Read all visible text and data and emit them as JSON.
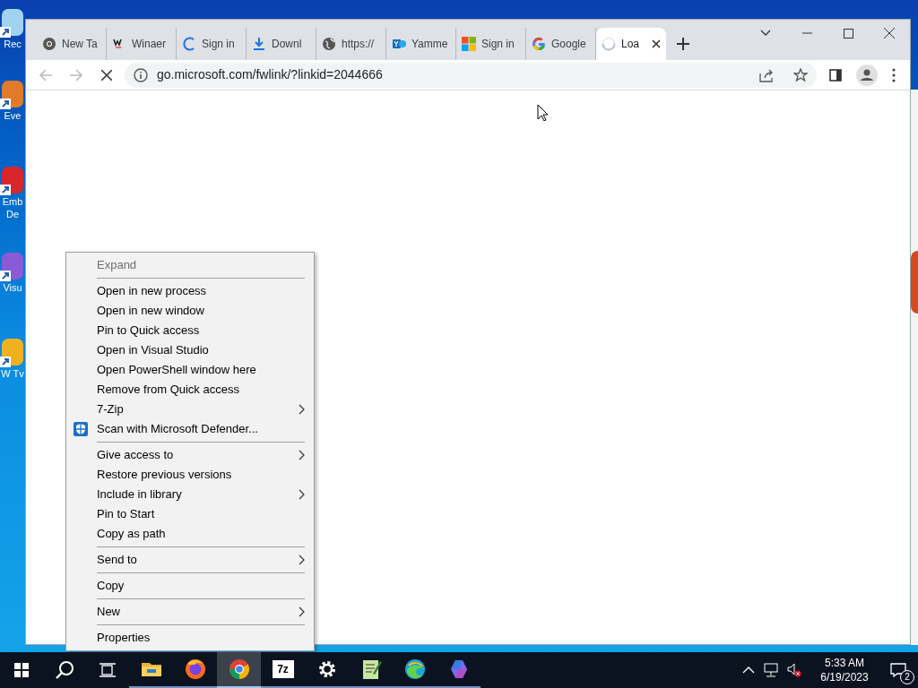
{
  "desktop_icons": [
    {
      "label": "Rec"
    },
    {
      "label": "Eve"
    },
    {
      "label": "Emb De"
    },
    {
      "label": "Visu"
    },
    {
      "label": "W Tv"
    }
  ],
  "browser": {
    "tabs": [
      {
        "label": "New Ta",
        "selected": false
      },
      {
        "label": "Winaer",
        "selected": false
      },
      {
        "label": "Sign in",
        "selected": false
      },
      {
        "label": "Downl",
        "selected": false
      },
      {
        "label": "https://",
        "selected": false
      },
      {
        "label": "Yamme",
        "selected": false
      },
      {
        "label": "Sign in",
        "selected": false
      },
      {
        "label": "Google",
        "selected": false
      },
      {
        "label": "Loa",
        "selected": true
      }
    ],
    "url": "go.microsoft.com/fwlink/?linkid=2044666"
  },
  "context_menu": [
    {
      "kind": "item",
      "label": "Expand",
      "disabled": true,
      "submenu": false
    },
    {
      "kind": "separator"
    },
    {
      "kind": "item",
      "label": "Open in new process",
      "disabled": false,
      "submenu": false
    },
    {
      "kind": "item",
      "label": "Open in new window",
      "disabled": false,
      "submenu": false
    },
    {
      "kind": "item",
      "label": "Pin to Quick access",
      "disabled": false,
      "submenu": false
    },
    {
      "kind": "item",
      "label": "Open in Visual Studio",
      "disabled": false,
      "submenu": false
    },
    {
      "kind": "item",
      "label": "Open PowerShell window here",
      "disabled": false,
      "submenu": false
    },
    {
      "kind": "item",
      "label": "Remove from Quick access",
      "disabled": false,
      "submenu": false
    },
    {
      "kind": "item",
      "label": "7-Zip",
      "disabled": false,
      "submenu": true
    },
    {
      "kind": "item",
      "label": "Scan with Microsoft Defender...",
      "disabled": false,
      "submenu": false
    },
    {
      "kind": "separator"
    },
    {
      "kind": "item",
      "label": "Give access to",
      "disabled": false,
      "submenu": true
    },
    {
      "kind": "item",
      "label": "Restore previous versions",
      "disabled": false,
      "submenu": false
    },
    {
      "kind": "item",
      "label": "Include in library",
      "disabled": false,
      "submenu": true
    },
    {
      "kind": "item",
      "label": "Pin to Start",
      "disabled": false,
      "submenu": false
    },
    {
      "kind": "item",
      "label": "Copy as path",
      "disabled": false,
      "submenu": false
    },
    {
      "kind": "separator"
    },
    {
      "kind": "item",
      "label": "Send to",
      "disabled": false,
      "submenu": true
    },
    {
      "kind": "separator"
    },
    {
      "kind": "item",
      "label": "Copy",
      "disabled": false,
      "submenu": false
    },
    {
      "kind": "separator"
    },
    {
      "kind": "item",
      "label": "New",
      "disabled": false,
      "submenu": true
    },
    {
      "kind": "separator"
    },
    {
      "kind": "item",
      "label": "Properties",
      "disabled": false,
      "submenu": false
    }
  ],
  "taskbar": {
    "apps": [
      {
        "selected": false
      },
      {
        "selected": false
      },
      {
        "selected": true
      },
      {
        "label": "7z",
        "selected": false
      },
      {
        "selected": false
      },
      {
        "selected": false
      },
      {
        "selected": false
      },
      {
        "selected": false
      }
    ],
    "time": "5:33 AM",
    "date": "6/19/2023",
    "notifications": "2"
  }
}
